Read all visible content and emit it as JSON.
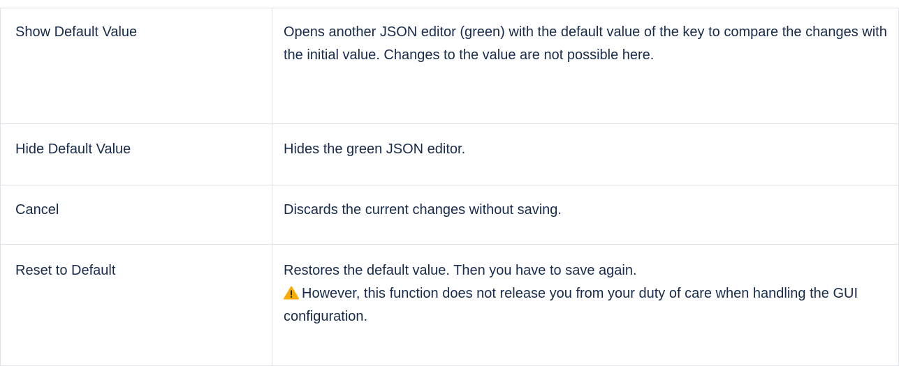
{
  "table": {
    "rows": [
      {
        "name": "Show Default Value",
        "description": "Opens another JSON editor (green) with the default value of the key to compare the changes with the initial value. Changes to the value are not possible here."
      },
      {
        "name": "Hide Default Value",
        "description": "Hides the green JSON editor."
      },
      {
        "name": "Cancel",
        "description": "Discards the current changes without saving."
      },
      {
        "name": "Reset to Default",
        "description": "Restores the default value. Then you have to save again.",
        "warning": "However, this function does not release you from your duty of care when handling the GUI configuration.",
        "warning_icon": "warning-triangle-icon",
        "warning_color": "#ffab00"
      }
    ]
  }
}
